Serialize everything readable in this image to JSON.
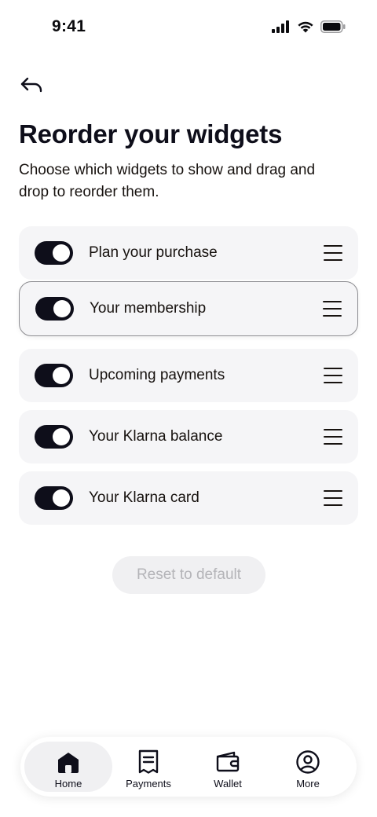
{
  "status_bar": {
    "time": "9:41",
    "icons": [
      "cellular-signal-icon",
      "wifi-icon",
      "battery-icon"
    ]
  },
  "header": {
    "back_icon": "back-arrow-icon",
    "title": "Reorder your widgets",
    "subtitle": "Choose which widgets to show and drag and drop to reorder them."
  },
  "widgets": [
    {
      "label": "Plan your purchase",
      "enabled": true,
      "dragging": false
    },
    {
      "label": "Your membership",
      "enabled": true,
      "dragging": true
    },
    {
      "label": "Upcoming payments",
      "enabled": true,
      "dragging": false
    },
    {
      "label": "Your Klarna balance",
      "enabled": true,
      "dragging": false
    },
    {
      "label": "Your Klarna card",
      "enabled": true,
      "dragging": false
    }
  ],
  "reset_button": {
    "label": "Reset to default",
    "disabled": true
  },
  "tab_bar": {
    "tabs": [
      {
        "label": "Home",
        "icon": "home-icon",
        "active": true
      },
      {
        "label": "Payments",
        "icon": "receipt-icon",
        "active": false
      },
      {
        "label": "Wallet",
        "icon": "wallet-icon",
        "active": false
      },
      {
        "label": "More",
        "icon": "profile-icon",
        "active": false
      }
    ]
  },
  "colors": {
    "primary": "#0e0e1a",
    "row_background": "#f5f5f7",
    "disabled_text": "#b4b4b8",
    "active_tab_background": "#f0f0f2"
  }
}
